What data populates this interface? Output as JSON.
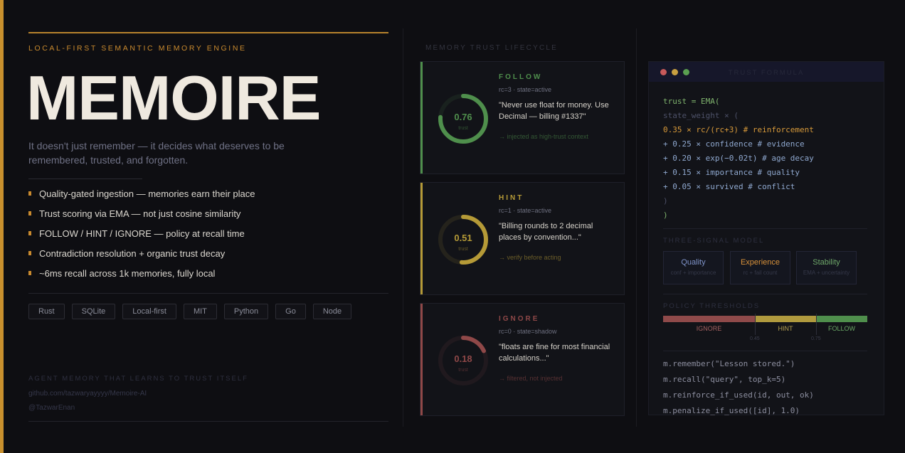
{
  "left": {
    "eyebrow": "LOCAL-FIRST SEMANTIC MEMORY ENGINE",
    "title": "MEMOIRE",
    "tagline": "It doesn't just remember — it decides what deserves to be remembered, trusted, and forgotten.",
    "features": [
      "Quality-gated ingestion — memories earn their place",
      "Trust scoring via EMA — not just cosine similarity",
      "FOLLOW / HINT / IGNORE — policy at recall time",
      "Contradiction resolution + organic trust decay",
      "~6ms recall across 1k memories, fully local"
    ],
    "tags": [
      "Rust",
      "SQLite",
      "Local-first",
      "MIT",
      "Python",
      "Go",
      "Node"
    ],
    "footer_eyebrow": "AGENT MEMORY THAT LEARNS TO TRUST ITSELF",
    "footer_link": "github.com/tazwaryayyyy/Memoire-AI",
    "footer_handle": "@TazwarEnan"
  },
  "middle": {
    "eyebrow": "MEMORY TRUST LIFECYCLE",
    "cards": [
      {
        "state": "FOLLOW",
        "meta": "rc=3 · state=active",
        "quote": "\"Never use float for money. Use Decimal — billing #1337\"",
        "note": "→ injected as high-trust context",
        "trust": 0.76,
        "trust_label": "0.76",
        "sub": "trust",
        "color": "#4f8f4c"
      },
      {
        "state": "HINT",
        "meta": "rc=1 · state=active",
        "quote": "\"Billing rounds to 2 decimal places by convention...\"",
        "note": "→ verify before acting",
        "trust": 0.51,
        "trust_label": "0.51",
        "sub": "trust",
        "color": "#b59a37"
      },
      {
        "state": "IGNORE",
        "meta": "rc=0 · state=shadow",
        "quote": "\"floats are fine for most financial calculations...\"",
        "note": "→ filtered, not injected",
        "trust": 0.18,
        "trust_label": "0.18",
        "sub": "trust",
        "color": "#8f4848"
      }
    ]
  },
  "right": {
    "window_title": "TRUST FORMULA",
    "window_dots": [
      "#c85a5a",
      "#c8a040",
      "#5aa050"
    ],
    "formula": [
      {
        "text": "trust = EMA(",
        "color": "#7fb36d"
      },
      {
        "text": "state_weight × (",
        "color": "#4d5168"
      },
      {
        "text": "0.35 × rc/(rc+3) # reinforcement",
        "color": "#d89a3a"
      },
      {
        "text": "+ 0.25 × confidence # evidence",
        "color": "#8fa8cf"
      },
      {
        "text": "+ 0.20 × exp(−0.02t) # age decay",
        "color": "#8fa8cf"
      },
      {
        "text": "+ 0.15 × importance # quality",
        "color": "#8fa8cf"
      },
      {
        "text": "+ 0.05 × survived # conflict",
        "color": "#8fa8cf"
      },
      {
        "text": ")",
        "color": "#4d5168"
      },
      {
        "text": ")",
        "color": "#7fb36d"
      }
    ],
    "signals_eyebrow": "THREE-SIGNAL MODEL",
    "signals": [
      {
        "name": "Quality",
        "sub": "conf + importance",
        "color": "#7f93c9"
      },
      {
        "name": "Experience",
        "sub": "rc + fail count",
        "color": "#d8913a"
      },
      {
        "name": "Stability",
        "sub": "EMA + uncertainty",
        "color": "#6fa96a"
      }
    ],
    "thresholds_eyebrow": "POLICY THRESHOLDS",
    "thresholds": [
      {
        "label": "IGNORE",
        "color": "#8f4a4a",
        "label_color": "#a36060"
      },
      {
        "label": "HINT",
        "color": "#b09a3e",
        "label_color": "#b5a050"
      },
      {
        "label": "FOLLOW",
        "color": "#4f8f4c",
        "label_color": "#6aa865"
      }
    ],
    "threshold_values": [
      "0.45",
      "0.75"
    ],
    "api": [
      "m.remember(\"Lesson stored.\")",
      "m.recall(\"query\", top_k=5)",
      "m.reinforce_if_used(id, out, ok)",
      "m.penalize_if_used([id], 1.0)"
    ]
  }
}
